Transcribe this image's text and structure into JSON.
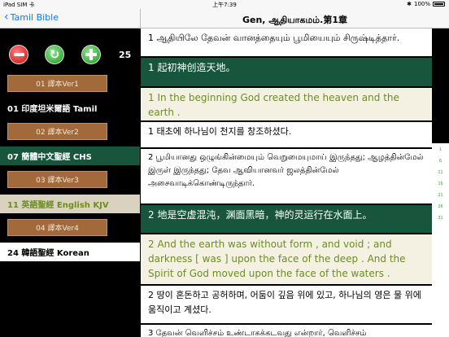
{
  "status": {
    "left": "iPad SIM 卡",
    "time": "上午7:39",
    "battery": "100%"
  },
  "nav": {
    "back_label": "Tamil Bible",
    "title": "Gen, ஆதியாகமம்.第1章"
  },
  "toolbar": {
    "count": "25"
  },
  "versions": [
    {
      "button": "01 譯本Ver1",
      "current": "01 印度坦米爾語 Tamil"
    },
    {
      "button": "02 譯本Ver2",
      "current": "07 簡體中文聖經 CHS"
    },
    {
      "button": "03 譯本Ver3",
      "current": "11 英語聖經 English KJV"
    },
    {
      "button": "04 譯本Ver4",
      "current": "24 韓語聖經 Korean"
    }
  ],
  "verses": [
    "1 ஆதியிலே தேவன் வானத்தையும் பூமியையும் சிருஷ்டித்தார்.",
    "1 起初神创造天地。",
    "1 In the beginning God created the heaven and the earth .",
    "1 태초에 하나님이 천지를 창조하셨다.",
    "2 பூமியானது ஒழுங்கின்மையும் வெறுமையுமாய் இருந்தது; ஆழத்தின்மேல் இருள் இருந்தது; தேவ ஆவியானவர் ஜலத்தின்மேல் அசைவாடிக்கொண்டிருந்தார்.",
    "2 地是空虚混沌，渊面黑暗，神的灵运行在水面上。",
    "2 And the earth was without form , and void ; and darkness [ was ] upon the face of the deep . And the Spirit of God moved upon the face of the waters .",
    "2 땅이 혼돈하고 공허하며, 어둠이 깊음 위에 있고, 하나님의 영은 물 위에 움직이고 계셨다.",
    "3 தேவன் வெளிச்சம் உண்டாகக்கடவது என்றார், வெளிச்சம்"
  ],
  "scroll_index": [
    "1",
    "6",
    "11",
    "16",
    "21",
    "26",
    "31"
  ]
}
